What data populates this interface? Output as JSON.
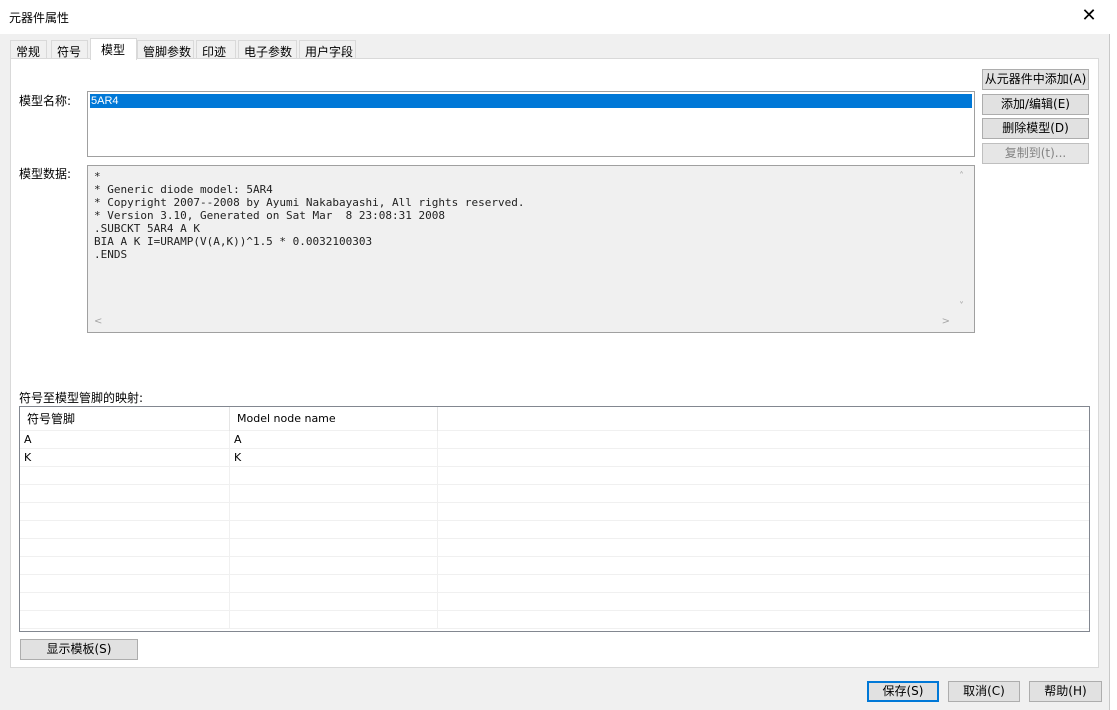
{
  "window": {
    "title": "元器件属性",
    "close_glyph": "✕"
  },
  "tabs": [
    "常规",
    "符号",
    "模型",
    "管脚参数",
    "印迹",
    "电子参数",
    "用户字段"
  ],
  "model": {
    "name_label": "模型名称:",
    "name_selected": "5AR4",
    "data_label": "模型数据:",
    "data_lines": [
      "*",
      "* Generic diode model: 5AR4",
      "* Copyright 2007--2008 by Ayumi Nakabayashi, All rights reserved.",
      "* Version 3.10, Generated on Sat Mar  8 23:08:31 2008",
      ".SUBCKT 5AR4 A K",
      "BIA A K I=URAMP(V(A,K))^1.5 * 0.0032100303",
      ".ENDS"
    ]
  },
  "side_buttons": {
    "add_from_component": "从元器件中添加(A)",
    "add_edit": "添加/编辑(E)",
    "delete_model": "删除模型(D)",
    "copy_to": "复制到(t)..."
  },
  "mapping": {
    "label": "符号至模型管脚的映射:",
    "columns": [
      "符号管脚",
      "Model node name"
    ],
    "rows": [
      [
        "A",
        "A"
      ],
      [
        "K",
        "K"
      ]
    ]
  },
  "show_template_button": "显示模板(S)",
  "footer": {
    "save": "保存(S)",
    "cancel": "取消(C)",
    "help": "帮助(H)"
  }
}
